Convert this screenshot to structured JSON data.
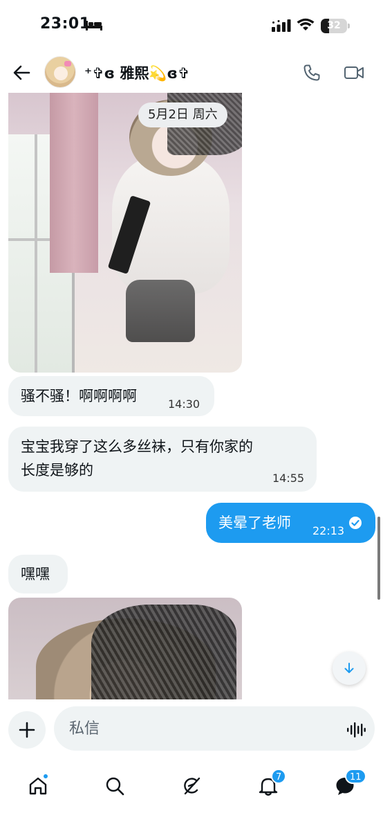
{
  "status_bar": {
    "time": "23:01",
    "battery_level": "32",
    "battery_fraction": 0.32,
    "icons": [
      "bed-icon",
      "cellular-signal-icon",
      "wifi-icon",
      "battery-icon"
    ]
  },
  "header": {
    "display_name": "⁺✞ɞ 雅熙💫ɞ✞",
    "icons": [
      "back-arrow-icon",
      "phone-icon",
      "video-camera-icon"
    ]
  },
  "chat": {
    "date_chip": "5月2日 周六",
    "messages": [
      {
        "direction": "in",
        "text": "骚不骚！啊啊啊啊",
        "time": "14:30"
      },
      {
        "direction": "in",
        "line1": "宝宝我穿了这么多丝袜，只有你家的",
        "line2": "长度是够的",
        "time": "14:55"
      },
      {
        "direction": "out",
        "text": "美晕了老师",
        "time": "22:13",
        "status_icon": "read-check-icon"
      },
      {
        "direction": "in",
        "text": "嘿嘿"
      }
    ]
  },
  "composer": {
    "placeholder": "私信",
    "icons": [
      "plus-icon",
      "voice-waveform-icon"
    ]
  },
  "bottom_nav": {
    "items": [
      {
        "name": "home",
        "icon": "home-icon",
        "has_dot": true
      },
      {
        "name": "search",
        "icon": "search-icon"
      },
      {
        "name": "grok",
        "icon": "grok-icon"
      },
      {
        "name": "notifications",
        "icon": "bell-icon",
        "badge": "7"
      },
      {
        "name": "messages",
        "icon": "messages-icon",
        "badge": "11",
        "active": true
      }
    ]
  },
  "colors": {
    "accent": "#1d9bf0",
    "incoming_bubble": "#eff3f4",
    "text": "#0f1419"
  }
}
